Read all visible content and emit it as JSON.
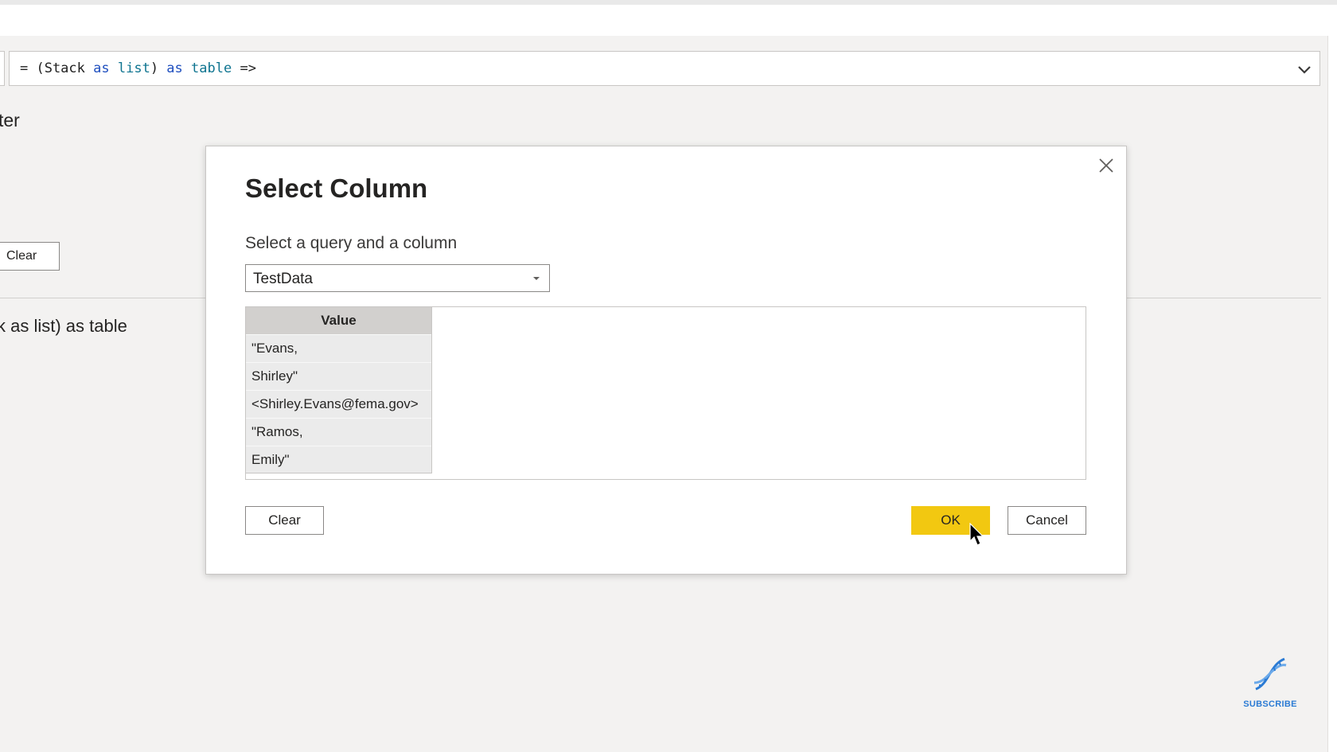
{
  "formula_bar": {
    "prefix": "= (Stack ",
    "kw_as_1": "as",
    "space_1": " ",
    "type_list": "list",
    "close_paren": ") ",
    "kw_as_2": "as",
    "space_2": " ",
    "type_table": "table",
    "arrow": " =>"
  },
  "background": {
    "partial_label": "ter",
    "clear_label": "Clear",
    "function_text": "k as list) as table"
  },
  "dialog": {
    "title": "Select Column",
    "subtitle": "Select a query and a column",
    "query_selected": "TestData",
    "column_header": "Value",
    "rows": [
      "\"Evans,",
      "Shirley\"",
      "<Shirley.Evans@fema.gov>",
      "\"Ramos,",
      "Emily\""
    ],
    "buttons": {
      "clear": "Clear",
      "ok": "OK",
      "cancel": "Cancel"
    }
  },
  "subscribe": {
    "label": "SUBSCRIBE",
    "icon": "dna-icon"
  },
  "colors": {
    "ok_button": "#f2c811",
    "app_background": "#f3f2f1",
    "keyword": "#1f4fbf",
    "type": "#0e7490",
    "subscribe": "#2b7bd4"
  }
}
